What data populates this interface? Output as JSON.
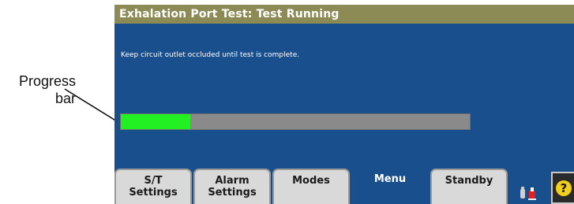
{
  "annotation": {
    "line1": "Progress",
    "line2": "bar"
  },
  "screen": {
    "title": "Exhalation Port Test:  Test Running",
    "instruction": "Keep circuit outlet occluded until test is complete.",
    "progress_fraction": 0.2
  },
  "tabs": [
    {
      "line1": "S/T",
      "line2": "Settings",
      "active": false
    },
    {
      "line1": "Alarm",
      "line2": "Settings",
      "active": false
    },
    {
      "line1": "Modes",
      "line2": "",
      "active": false
    },
    {
      "line1": "Menu",
      "line2": "",
      "active": true
    },
    {
      "line1": "Standby",
      "line2": "",
      "active": false
    }
  ],
  "icons": {
    "status": "alarm-status-icon",
    "help": "help-icon",
    "help_glyph": "?"
  },
  "colors": {
    "screen_bg": "#1a4f8e",
    "title_bar": "#8c8a55",
    "progress_fill": "#22f022",
    "progress_track": "#8a8a8a",
    "help_yellow": "#f2cf19"
  }
}
